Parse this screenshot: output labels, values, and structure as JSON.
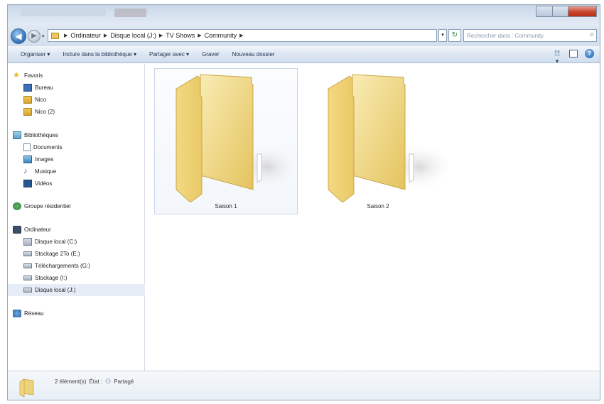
{
  "address": {
    "crumbs": [
      "Ordinateur",
      "Disque local (J:)",
      "TV Shows",
      "Community"
    ],
    "search_placeholder": "Rechercher dans : Community"
  },
  "toolbar": {
    "organize": "Organiser ▾",
    "include_in_library": "Inclure dans la bibliothèque ▾",
    "share_with": "Partager avec ▾",
    "burn": "Graver",
    "new_folder": "Nouveau dossier"
  },
  "nav": {
    "favorites": {
      "label": "Favoris",
      "items": [
        "Bureau",
        "Nico",
        "Nico (2)"
      ]
    },
    "libraries": {
      "label": "Bibliothèques",
      "items": [
        "Documents",
        "Images",
        "Musique",
        "Vidéos"
      ]
    },
    "homegroup": {
      "label": "Groupe résidentiel"
    },
    "computer": {
      "label": "Ordinateur",
      "items": [
        "Disque local (C:)",
        "Stockage 2To (E:)",
        "Téléchargements (G:)",
        "Stockage (I:)",
        "Disque local (J:)"
      ],
      "selected_index": 4
    },
    "network": {
      "label": "Réseau"
    }
  },
  "content": {
    "folders": [
      {
        "name": "Saison 1",
        "selected": true
      },
      {
        "name": "Saison 2",
        "selected": false
      }
    ]
  },
  "details": {
    "count": "2 élément(s)",
    "state": "État :",
    "shared": "Partagé"
  },
  "colors": {
    "folder_light": "#f6e6a2",
    "folder_dark": "#e0bd55",
    "accent": "#2f6eb6",
    "close": "#c8452c"
  }
}
